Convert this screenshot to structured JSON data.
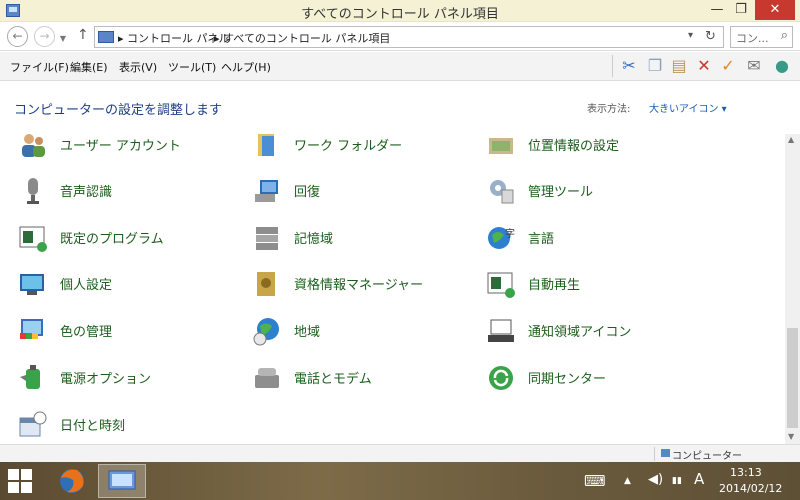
{
  "window": {
    "title": "すべてのコントロール パネル項目",
    "min_glyph": "—",
    "max_glyph": "❐",
    "close_glyph": "✕"
  },
  "address": {
    "crumbs": [
      "コントロール パネル",
      "すべてのコントロール パネル項目"
    ],
    "search_placeholder": "コン..."
  },
  "menu": [
    "ファイル(F)",
    "編集(E)",
    "表示(V)",
    "ツール(T)",
    "ヘルプ(H)"
  ],
  "header": {
    "heading": "コンピューターの設定を調整します",
    "view_by_label": "表示方法:",
    "view_by_value": "大きいアイコン ▾"
  },
  "items": [
    {
      "label": "ユーザー アカウント",
      "icon": "users-icon"
    },
    {
      "label": "ワーク フォルダー",
      "icon": "work-folders-icon"
    },
    {
      "label": "位置情報の設定",
      "icon": "location-icon"
    },
    {
      "label": "音声認識",
      "icon": "microphone-icon"
    },
    {
      "label": "回復",
      "icon": "recovery-icon"
    },
    {
      "label": "管理ツール",
      "icon": "admin-tools-icon"
    },
    {
      "label": "既定のプログラム",
      "icon": "default-programs-icon"
    },
    {
      "label": "記憶域",
      "icon": "storage-icon"
    },
    {
      "label": "言語",
      "icon": "language-icon"
    },
    {
      "label": "個人設定",
      "icon": "personalization-icon"
    },
    {
      "label": "資格情報マネージャー",
      "icon": "credential-manager-icon"
    },
    {
      "label": "自動再生",
      "icon": "autoplay-icon"
    },
    {
      "label": "色の管理",
      "icon": "color-management-icon"
    },
    {
      "label": "地域",
      "icon": "region-icon"
    },
    {
      "label": "通知領域アイコン",
      "icon": "notification-area-icon"
    },
    {
      "label": "電源オプション",
      "icon": "power-options-icon"
    },
    {
      "label": "電話とモデム",
      "icon": "phone-modem-icon"
    },
    {
      "label": "同期センター",
      "icon": "sync-center-icon"
    },
    {
      "label": "日付と時刻",
      "icon": "date-time-icon"
    }
  ],
  "status": {
    "text": "コンピューター"
  },
  "taskbar": {
    "time": "13:13",
    "date": "2014/02/12",
    "ime": "A"
  },
  "colors": {
    "item_text": "#1c5d1c",
    "heading": "#1e3e84",
    "close_button": "#c7392e"
  }
}
